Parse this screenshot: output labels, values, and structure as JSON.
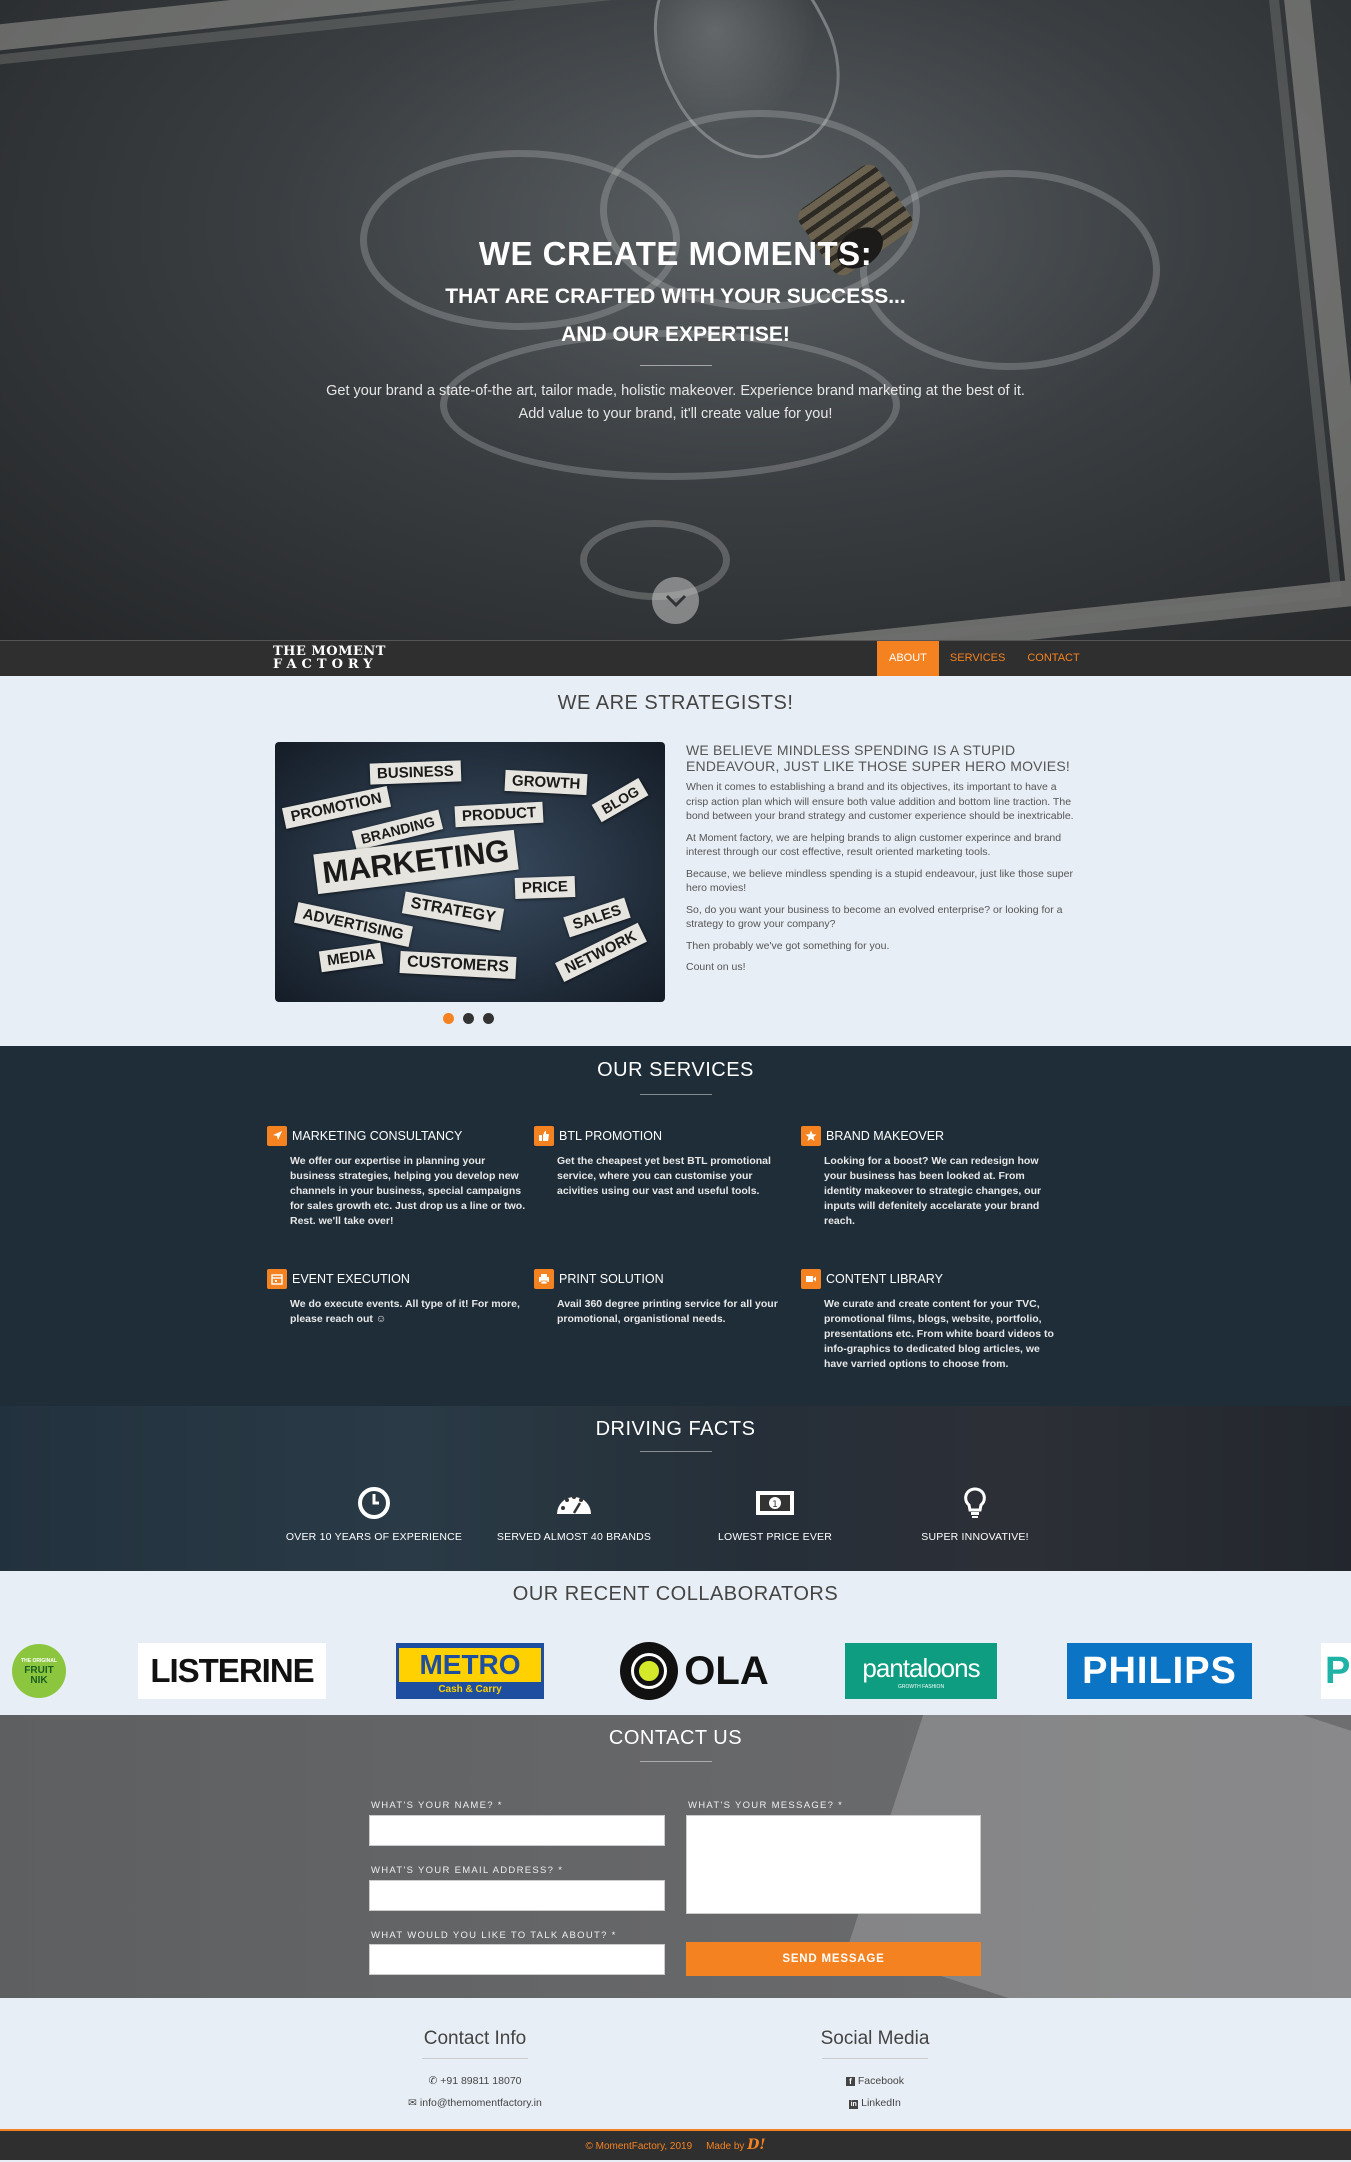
{
  "hero": {
    "title": "WE CREATE MOMENTS:",
    "subtitle1": "THAT ARE CRAFTED WITH YOUR SUCCESS...",
    "subtitle2": "AND OUR EXPERTISE!",
    "text1": "Get your brand a state-of-the art, tailor made, holistic makeover. Experience brand marketing at the best of it.",
    "text2": "Add value to your brand, it'll create value for you!"
  },
  "nav": {
    "brand_line1": "THE MOMENT",
    "brand_line2": "FACTORY",
    "links": [
      "ABOUT",
      "SERVICES",
      "CONTACT"
    ],
    "active_color": "#f58220"
  },
  "about": {
    "title": "WE ARE STRATEGISTS!",
    "heading": "WE BELIEVE MINDLESS SPENDING IS A STUPID ENDEAVOUR, JUST LIKE THOSE SUPER HERO MOVIES!",
    "paragraphs": [
      "When it comes to establishing a brand and its objectives, its important to have a crisp action plan which will ensure both value addition and bottom line traction. The bond between your brand strategy and customer experience should be inextricable.",
      "At Moment factory, we are helping brands to align customer experince and brand interest through our cost effective, result oriented marketing tools.",
      "Because, we believe mindless spending is a stupid endeavour, just like those super hero movies!",
      "So, do you want your business to become an evolved enterprise? or looking for a strategy to grow your company?",
      "Then probably we've got something for you.",
      "Count on us!"
    ],
    "image_words": [
      "BUSINESS",
      "GROWTH",
      "PROMOTION",
      "BRANDING",
      "PRODUCT",
      "BLOG",
      "MARKETING",
      "PRICE",
      "STRATEGY",
      "SALES",
      "ADVERTISING",
      "MEDIA",
      "CUSTOMERS",
      "NETWORK"
    ],
    "carousel_active": 0
  },
  "services": {
    "title": "OUR SERVICES",
    "items": [
      {
        "name": "MARKETING CONSULTANCY",
        "icon": "rocket-icon",
        "text": "We offer our expertise in planning your business strategies, helping you develop new channels in your business, special campaigns for sales growth etc. Just drop us a line or two. Rest. we'll take over!"
      },
      {
        "name": "BTL PROMOTION",
        "icon": "thumbs-up-icon",
        "text": "Get the cheapest yet best BTL promotional service, where you can customise your acivities using our vast and useful tools."
      },
      {
        "name": "BRAND MAKEOVER",
        "icon": "star-icon",
        "text": "Looking for a boost? We can redesign how your business has been looked at. From identity makeover to strategic changes, our inputs will defenitely accelarate your brand reach."
      },
      {
        "name": "EVENT EXECUTION",
        "icon": "calendar-icon",
        "text": "We do execute events. All type of it! For more, please reach out ☺"
      },
      {
        "name": "PRINT SOLUTION",
        "icon": "printer-icon",
        "text": "Avail 360 degree printing service for all your promotional, organistional needs."
      },
      {
        "name": "CONTENT LIBRARY",
        "icon": "video-camera-icon",
        "text": "We curate and create content for your TVC, promotional films, blogs, website, portfolio, presentations etc. From white board videos to info-graphics to dedicated blog articles, we have varried options to choose from."
      }
    ]
  },
  "facts": {
    "title": "DRIVING FACTS",
    "items": [
      {
        "label": "OVER 10 YEARS OF EXPERIENCE",
        "icon": "clock-icon"
      },
      {
        "label": "SERVED ALMOST 40 BRANDS",
        "icon": "dashboard-icon"
      },
      {
        "label": "LOWEST PRICE EVER",
        "icon": "money-icon"
      },
      {
        "label": "SUPER INNOVATIVE!",
        "icon": "lightbulb-icon"
      }
    ]
  },
  "collab": {
    "title": "OUR RECENT COLLABORATORS",
    "logos": [
      {
        "name": "FRUIT NIK",
        "tag": "THE ORIGINAL"
      },
      {
        "name": "LISTERINE"
      },
      {
        "name": "METRO",
        "sub": "Cash & Carry"
      },
      {
        "name": "OLA"
      },
      {
        "name": "pantaloons",
        "sub": "GROWTH FASHION"
      },
      {
        "name": "PHILIPS"
      },
      {
        "name": "P"
      }
    ]
  },
  "contact": {
    "title": "CONTACT US",
    "name_label": "WHAT'S YOUR NAME? *",
    "email_label": "WHAT'S YOUR EMAIL ADDRESS? *",
    "topic_label": "WHAT WOULD YOU LIKE TO TALK ABOUT? *",
    "message_label": "WHAT'S YOUR MESSAGE? *",
    "send_label": "SEND MESSAGE"
  },
  "info": {
    "contact_title": "Contact Info",
    "phone": "+91 89811 18070",
    "email": "info@themomentfactory.in",
    "social_title": "Social Media",
    "facebook": "Facebook",
    "linkedin": "LinkedIn"
  },
  "footer": {
    "copyright": "© MomentFactory, 2019",
    "made_by": "Made by",
    "maker_logo": "D!"
  }
}
